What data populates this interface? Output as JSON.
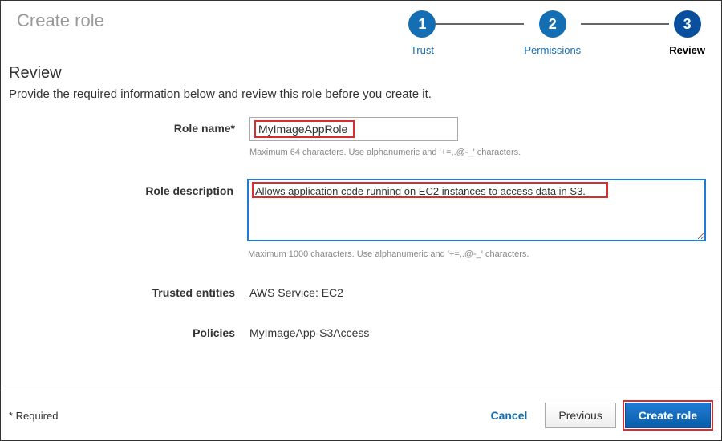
{
  "header": {
    "title": "Create role"
  },
  "stepper": {
    "step1": {
      "num": "1",
      "label": "Trust"
    },
    "step2": {
      "num": "2",
      "label": "Permissions"
    },
    "step3": {
      "num": "3",
      "label": "Review"
    }
  },
  "section": {
    "title": "Review",
    "subtitle": "Provide the required information below and review this role before you create it."
  },
  "form": {
    "roleName": {
      "label": "Role name*",
      "value": "MyImageAppRole",
      "help": "Maximum 64 characters. Use alphanumeric and '+=,.@-_' characters."
    },
    "roleDesc": {
      "label": "Role description",
      "value": "Allows application code running on EC2 instances to access data in S3.",
      "help": "Maximum 1000 characters. Use alphanumeric and '+=,.@-_' characters."
    },
    "trustedEntities": {
      "label": "Trusted entities",
      "value": "AWS Service: EC2"
    },
    "policies": {
      "label": "Policies",
      "value": "MyImageApp-S3Access"
    }
  },
  "footer": {
    "required": "* Required",
    "cancel": "Cancel",
    "previous": "Previous",
    "create": "Create role"
  }
}
